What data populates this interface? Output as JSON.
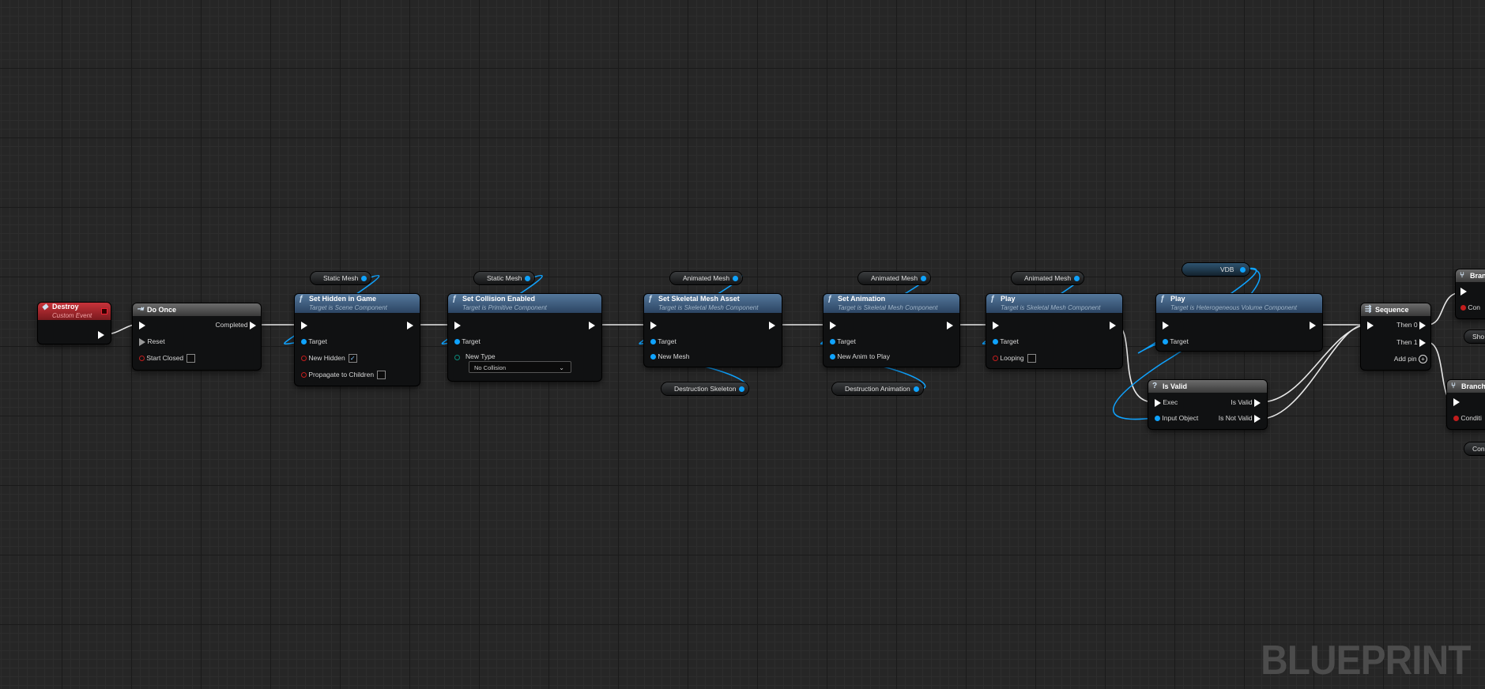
{
  "watermark": "BLUEPRINT",
  "colors": {
    "exec": "#ffffff",
    "object_pin": "#0fa3ff",
    "bool_pin": "#c21d1d",
    "function_header": "#3d5f82",
    "event_header": "#a8282e"
  },
  "nodes": {
    "destroy": {
      "title": "Destroy",
      "subtitle": "Custom Event"
    },
    "do_once": {
      "title": "Do Once",
      "completed": "Completed",
      "reset": "Reset",
      "start_closed": "Start Closed"
    },
    "set_hidden": {
      "title": "Set Hidden in Game",
      "subtitle": "Target is Scene Component",
      "target": "Target",
      "new_hidden": "New Hidden",
      "propagate": "Propagate to Children",
      "var": "Static Mesh"
    },
    "set_collision": {
      "title": "Set Collision Enabled",
      "subtitle": "Target is Primitive Component",
      "target": "Target",
      "new_type": "New Type",
      "new_type_value": "No Collision",
      "var": "Static Mesh"
    },
    "set_skel": {
      "title": "Set Skeletal Mesh Asset",
      "subtitle": "Target is Skeletal Mesh Component",
      "target": "Target",
      "new_mesh": "New Mesh",
      "var": "Animated Mesh",
      "var2": "Destruction Skeleton"
    },
    "set_anim": {
      "title": "Set Animation",
      "subtitle": "Target is Skeletal Mesh Component",
      "target": "Target",
      "new_anim": "New Anim to Play",
      "var": "Animated Mesh",
      "var2": "Destruction Animation"
    },
    "play1": {
      "title": "Play",
      "subtitle": "Target is Skeletal Mesh Component",
      "target": "Target",
      "looping": "Looping",
      "var": "Animated Mesh"
    },
    "play2": {
      "title": "Play",
      "subtitle": "Target is Heterogeneous Volume Component",
      "target": "Target",
      "var": "VDB"
    },
    "is_valid": {
      "title": "Is Valid",
      "exec": "Exec",
      "input": "Input Object",
      "valid": "Is Valid",
      "not_valid": "Is Not Valid"
    },
    "sequence": {
      "title": "Sequence",
      "then0": "Then 0",
      "then1": "Then 1",
      "add_pin": "Add pin"
    },
    "branch1": {
      "title": "Branch",
      "cond": "Con"
    },
    "branch2": {
      "title": "Branch",
      "cond": "Conditi"
    },
    "partial1": {
      "label": "Sho"
    },
    "partial2": {
      "label": "Con"
    }
  }
}
